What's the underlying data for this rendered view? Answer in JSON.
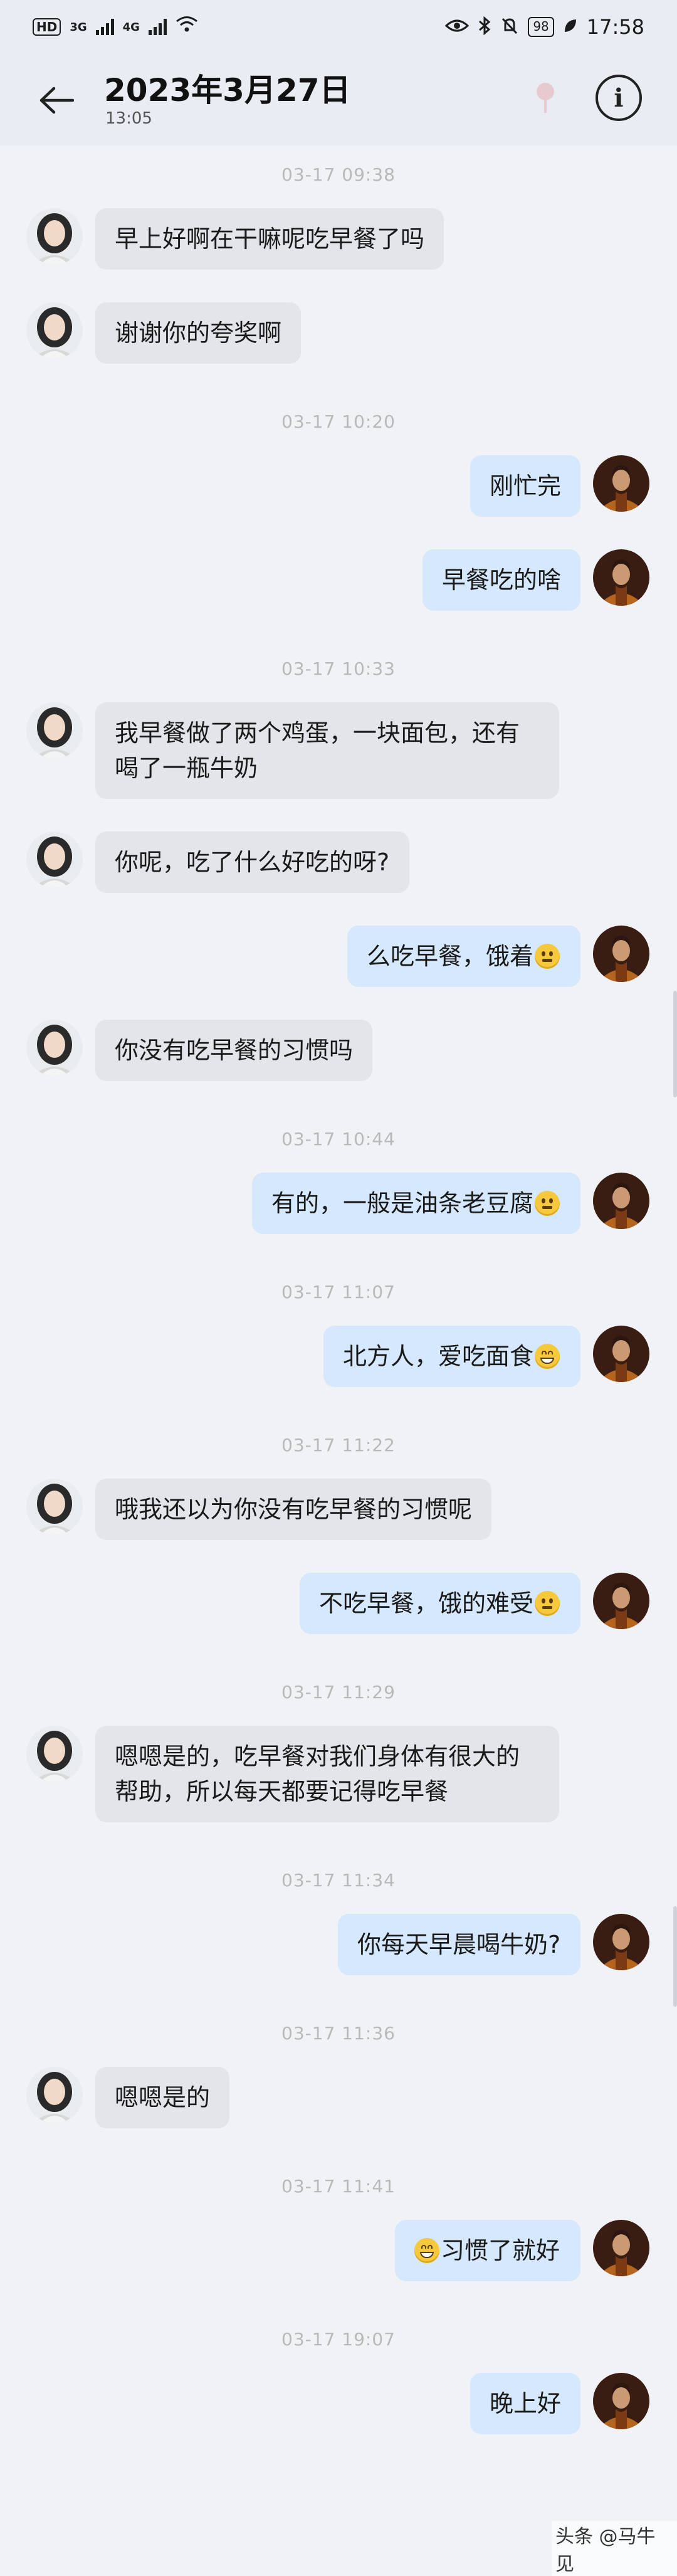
{
  "status_bar": {
    "hd": "HD",
    "net1": "3G",
    "net2": "4G",
    "battery": "98",
    "time": "17:58"
  },
  "header": {
    "title": "2023年3月27日",
    "subtitle": "13:05",
    "icons": [
      "back-arrow-icon",
      "pin-icon",
      "info-icon"
    ]
  },
  "messages": [
    {
      "type": "time",
      "text": "03-17 09:38"
    },
    {
      "type": "msg",
      "side": "in",
      "text": "早上好啊在干嘛呢吃早餐了吗"
    },
    {
      "type": "msg",
      "side": "in",
      "text": "谢谢你的夸奖啊"
    },
    {
      "type": "time",
      "text": "03-17 10:20"
    },
    {
      "type": "msg",
      "side": "out",
      "text": "刚忙完"
    },
    {
      "type": "msg",
      "side": "out",
      "text": "早餐吃的啥"
    },
    {
      "type": "time",
      "text": "03-17 10:33"
    },
    {
      "type": "msg",
      "side": "in",
      "text": "我早餐做了两个鸡蛋，一块面包，还有喝了一瓶牛奶"
    },
    {
      "type": "msg",
      "side": "in",
      "text": "你呢，吃了什么好吃的呀?"
    },
    {
      "type": "msg",
      "side": "out",
      "text": "么吃早餐，饿着",
      "emoji": "neutral-face-emoji"
    },
    {
      "type": "msg",
      "side": "in",
      "text": "你没有吃早餐的习惯吗"
    },
    {
      "type": "time",
      "text": "03-17 10:44"
    },
    {
      "type": "msg",
      "side": "out",
      "text": "有的，一般是油条老豆腐",
      "emoji": "neutral-face-emoji"
    },
    {
      "type": "time",
      "text": "03-17 11:07"
    },
    {
      "type": "msg",
      "side": "out",
      "text": "北方人，爱吃面食",
      "emoji": "grinning-face-emoji"
    },
    {
      "type": "time",
      "text": "03-17 11:22"
    },
    {
      "type": "msg",
      "side": "in",
      "text": "哦我还以为你没有吃早餐的习惯呢"
    },
    {
      "type": "msg",
      "side": "out",
      "text": "不吃早餐，饿的难受",
      "emoji": "neutral-face-emoji"
    },
    {
      "type": "time",
      "text": "03-17 11:29"
    },
    {
      "type": "msg",
      "side": "in",
      "text": "嗯嗯是的，吃早餐对我们身体有很大的帮助，所以每天都要记得吃早餐"
    },
    {
      "type": "time",
      "text": "03-17 11:34"
    },
    {
      "type": "msg",
      "side": "out",
      "text": "你每天早晨喝牛奶?"
    },
    {
      "type": "time",
      "text": "03-17 11:36"
    },
    {
      "type": "msg",
      "side": "in",
      "text": "嗯嗯是的"
    },
    {
      "type": "time",
      "text": "03-17 11:41"
    },
    {
      "type": "msg",
      "side": "out",
      "text": "习惯了就好",
      "emoji": "grinning-face-emoji",
      "emoji_leading": true
    },
    {
      "type": "time",
      "text": "03-17 19:07"
    },
    {
      "type": "msg",
      "side": "out",
      "text": "晚上好"
    }
  ],
  "watermark": "头条 @马牛见",
  "colors": {
    "background": "#f0f2f5",
    "bubble_in": "#e3e5ea",
    "bubble_out": "#d6e8fd",
    "timestamp": "#b9b9b9"
  }
}
